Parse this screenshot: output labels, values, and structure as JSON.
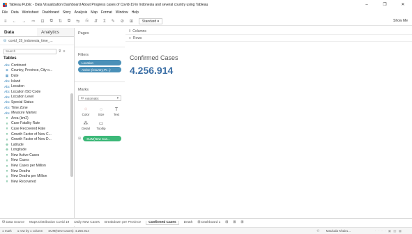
{
  "window": {
    "title": "Tableau Public - Data Visualization Dashboard About Progress cases of Covid-19 in Indonesia and several country using Tableau",
    "controls": [
      "–",
      "❐",
      "✕"
    ]
  },
  "menu": [
    "File",
    "Data",
    "Worksheet",
    "Dashboard",
    "Story",
    "Analysis",
    "Map",
    "Format",
    "Window",
    "Help"
  ],
  "toolbar": {
    "icons": [
      "≡",
      "←",
      "→",
      "⇨",
      "⊡",
      "⧉",
      "⇅",
      "⧉",
      "⇆",
      "⎌",
      "⇵",
      "Σ",
      "✎",
      "⊘",
      "⊞"
    ],
    "fit_label": "Standard",
    "show_me_label": "Show Me"
  },
  "sidepane": {
    "tab_data": "Data",
    "tab_analytics": "Analytics",
    "datasource": "covid_19_indonesia_time_...",
    "search_placeholder": "Search",
    "tables_heading": "Tables",
    "fields": [
      {
        "label": "Continent",
        "kind": "dim",
        "icon": "Abc"
      },
      {
        "label": "Country, Province, City o...",
        "kind": "dim",
        "icon": "⊕"
      },
      {
        "label": "Date",
        "kind": "dim",
        "icon": "▦"
      },
      {
        "label": "Island",
        "kind": "dim",
        "icon": "Abc"
      },
      {
        "label": "Location",
        "kind": "dim",
        "icon": "Abc"
      },
      {
        "label": "Location ISO Code",
        "kind": "dim",
        "icon": "Abc"
      },
      {
        "label": "Location Level",
        "kind": "dim",
        "icon": "Abc"
      },
      {
        "label": "Special Status",
        "kind": "dim",
        "icon": "Abc"
      },
      {
        "label": "Time Zone",
        "kind": "dim",
        "icon": "Abc"
      },
      {
        "label": "Measure Names",
        "kind": "dim",
        "icon": "Abc"
      },
      {
        "label": "Area (km2)",
        "kind": "meas",
        "icon": "#"
      },
      {
        "label": "Case Fatality Rate",
        "kind": "meas",
        "icon": "#"
      },
      {
        "label": "Case Recovered Rate",
        "kind": "meas",
        "icon": "#"
      },
      {
        "label": "Growth Factor of New C...",
        "kind": "meas",
        "icon": "#"
      },
      {
        "label": "Growth Factor of New D...",
        "kind": "meas",
        "icon": "#"
      },
      {
        "label": "Latitude",
        "kind": "meas",
        "icon": "⊕"
      },
      {
        "label": "Longitude",
        "kind": "meas",
        "icon": "⊕"
      },
      {
        "label": "New Active Cases",
        "kind": "meas",
        "icon": "#"
      },
      {
        "label": "New Cases",
        "kind": "meas",
        "icon": "#"
      },
      {
        "label": "New Cases per Million",
        "kind": "meas",
        "icon": "#"
      },
      {
        "label": "New Deaths",
        "kind": "meas",
        "icon": "#"
      },
      {
        "label": "New Deaths per Million",
        "kind": "meas",
        "icon": "#"
      },
      {
        "label": "New Recovered",
        "kind": "meas",
        "icon": "#"
      }
    ]
  },
  "cards": {
    "pages_label": "Pages",
    "filters_label": "Filters",
    "filter_pills": [
      "Location",
      "Action (Country,Pr...)"
    ],
    "marks_label": "Marks",
    "mark_type": "Automatic",
    "mark_buttons": [
      {
        "label": "Color",
        "glyph": "⁘"
      },
      {
        "label": "Size",
        "glyph": "◌"
      },
      {
        "label": "Text",
        "glyph": "T"
      },
      {
        "label": "Detail",
        "glyph": "⁂"
      },
      {
        "label": "Tooltip",
        "glyph": "▭"
      }
    ],
    "measure_pill": "SUM(New Cas..."
  },
  "shelves": {
    "columns_label": "Columns",
    "rows_label": "Rows"
  },
  "view": {
    "title": "Confirmed Cases",
    "value": "4.256.914"
  },
  "sheet_tabs": [
    {
      "label": "Data Source",
      "active": false
    },
    {
      "label": "Maps Distribution Covid 19",
      "active": false
    },
    {
      "label": "Daily New Cases",
      "active": false
    },
    {
      "label": "Breakdown per Province",
      "active": false
    },
    {
      "label": "Confirmed Cases",
      "active": true
    },
    {
      "label": "Death",
      "active": false
    },
    {
      "label": "Dashboard 1",
      "active": false
    }
  ],
  "status": {
    "marks": "1 mark",
    "rows_cols": "1 row by 1 column",
    "sum": "SUM(New Cases): 4.256.914",
    "user": "Mauluda Khairu..."
  }
}
